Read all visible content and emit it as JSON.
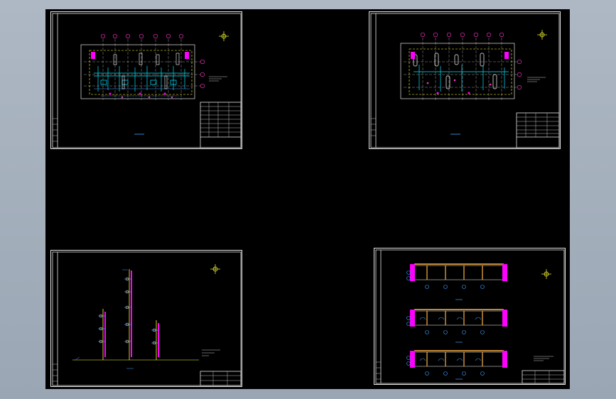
{
  "window": {
    "background_colors": [
      "#aeb8c4",
      "#000000"
    ]
  },
  "colors": {
    "frame": "#e6e6e6",
    "axis": "#ffffff",
    "pipe_cyan": "#00e5ff",
    "pipe_blue": "#41a0ff",
    "fixture_magenta": "#ff00ff",
    "bubble_magenta": "#ff33cc",
    "wall_yellow": "#ffff33",
    "beam_orange": "#ffb347"
  },
  "icons": {
    "north_marker": "compass-crosshair-icon",
    "grid_bubble": "grid-axis-bubble"
  },
  "sheets": [
    {
      "id": "sheet-1",
      "kind": "plan-drawing",
      "label": "",
      "notes": []
    },
    {
      "id": "sheet-2",
      "kind": "plan-drawing",
      "label": "",
      "notes": []
    },
    {
      "id": "sheet-3",
      "kind": "riser-diagram",
      "label": "",
      "notes": []
    },
    {
      "id": "sheet-4",
      "kind": "section-drawings",
      "label": "",
      "notes": []
    }
  ]
}
